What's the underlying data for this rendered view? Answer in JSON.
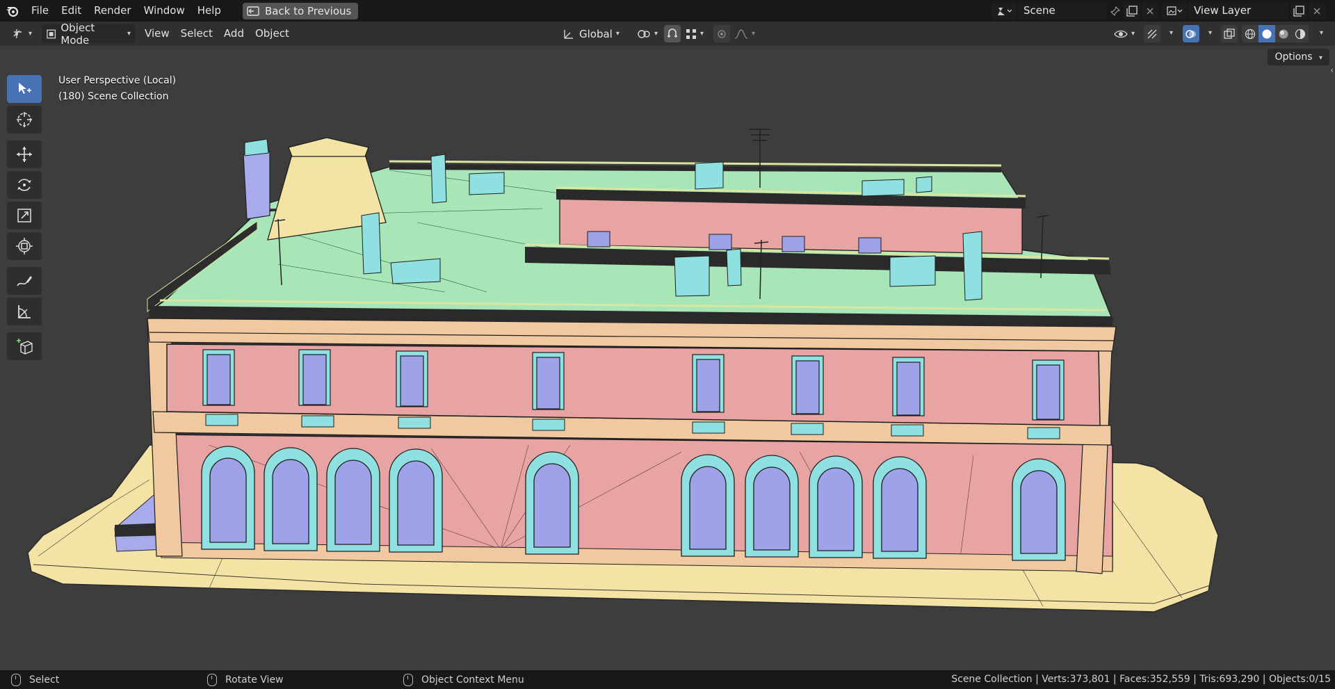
{
  "topbar": {
    "menus": [
      "File",
      "Edit",
      "Render",
      "Window",
      "Help"
    ],
    "back_button": "Back to Previous",
    "scene_name": "Scene",
    "view_layer_name": "View Layer"
  },
  "header": {
    "editor_type_icon": "3d-viewport-icon",
    "mode": "Object Mode",
    "menus": [
      "View",
      "Select",
      "Add",
      "Object"
    ],
    "orientation": "Global"
  },
  "viewport": {
    "perspective_label": "User Perspective (Local)",
    "collection_label": "(180) Scene Collection",
    "options_label": "Options"
  },
  "tools": [
    "select-box-icon",
    "cursor-icon",
    "move-icon",
    "rotate-icon",
    "scale-icon",
    "transform-icon",
    "annotate-icon",
    "measure-icon",
    "add-cube-icon"
  ],
  "statusbar": {
    "left_action": "Select",
    "middle_action": "Rotate View",
    "right_action": "Object Context Menu",
    "stats": "Scene Collection | Verts:373,801 | Faces:352,559 | Tris:693,290 | Objects:0/15"
  },
  "colors": {
    "accent": "#4772b3",
    "facade": "#e8a3a3",
    "roof": "#a8e6b8",
    "trim": "#f0c9a0",
    "ground": "#f3e3a4",
    "window": "#9ea2e8",
    "frame": "#8fe0e0"
  }
}
